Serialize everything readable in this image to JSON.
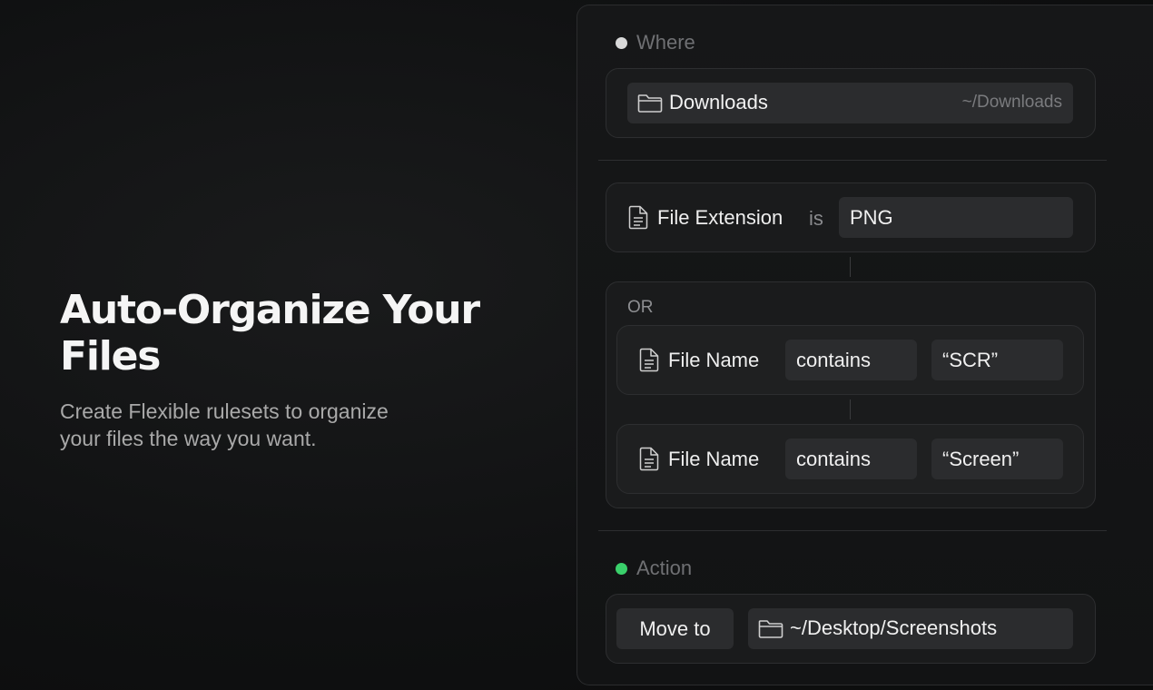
{
  "hero": {
    "title": "Auto-Organize Your Files",
    "subtitle": "Create Flexible rulesets to organize your files the way you want."
  },
  "where": {
    "label": "Where",
    "folder_icon": "folder-icon",
    "folder_name": "Downloads",
    "folder_path": "~/Downloads",
    "dot_color": "#d9d9d9"
  },
  "conditions": {
    "first": {
      "field": "File Extension",
      "operator": "is",
      "value": "PNG",
      "icon": "file-icon"
    },
    "group_label": "OR",
    "rules": [
      {
        "field": "File Name",
        "operator": "contains",
        "value": "“SCR”",
        "icon": "file-icon"
      },
      {
        "field": "File Name",
        "operator": "contains",
        "value": "“Screen”",
        "icon": "file-icon"
      }
    ]
  },
  "action": {
    "label": "Action",
    "dot_color": "#3ad06b",
    "verb": "Move to",
    "destination": "~/Desktop/Screenshots",
    "folder_icon": "folder-icon"
  }
}
